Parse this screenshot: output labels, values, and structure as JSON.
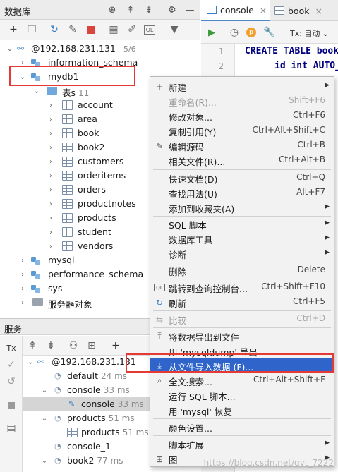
{
  "left_panel": {
    "title": "数据库",
    "header_icons": [
      "crosshair-icon",
      "collapse-icon",
      "expand-icon",
      "gear-icon",
      "minimize-icon"
    ]
  },
  "db_toolbar": {
    "icons": [
      "add-icon",
      "copy-icon",
      "refresh-icon",
      "edit-props-icon",
      "stop-icon",
      "table-view-icon",
      "pencil-icon",
      "query-console-icon",
      "filter-icon"
    ]
  },
  "tree": {
    "connection": {
      "label": "@192.168.231.131",
      "badge": "5/6"
    },
    "schema_information": "information_schema",
    "mydb": "mydb1",
    "tables_folder": {
      "label": "表s",
      "count": "11"
    },
    "tables": [
      "account",
      "area",
      "book",
      "book2",
      "customers",
      "orderitems",
      "orders",
      "productnotes",
      "products",
      "student",
      "vendors"
    ],
    "other_schemas": [
      "mysql",
      "performance_schema",
      "sys"
    ],
    "server_objects": "服务器对象"
  },
  "services": {
    "title": "服务",
    "tx_label": "Tx",
    "toolbar_icons": [
      "collapse-icon",
      "expand-icon",
      "group-icon",
      "layout-icon",
      "add-icon"
    ],
    "side_icons": [
      "check-icon",
      "rollback-icon",
      "stop-icon",
      "layout-icon"
    ],
    "tree": [
      {
        "label": "@192.168.231.131",
        "time": ""
      },
      {
        "label": "default",
        "time": "24 ms"
      },
      {
        "label": "console",
        "time": "33 ms"
      },
      {
        "label": "console",
        "time": "33 ms"
      },
      {
        "label": "products",
        "time": "51 ms"
      },
      {
        "label": "products",
        "time": "51 ms"
      },
      {
        "label": "console_1",
        "time": ""
      },
      {
        "label": "book2",
        "time": "77 ms"
      }
    ]
  },
  "editor": {
    "tabs": [
      {
        "label": "console",
        "close": "×"
      },
      {
        "label": "book",
        "close": "×"
      }
    ],
    "tx_label": "Tx: 自动",
    "line_numbers": [
      "1",
      "2"
    ],
    "code_lines": [
      "CREATE TABLE book",
      "id int AUTO_"
    ]
  },
  "context_menu": {
    "items": [
      {
        "label": "新建",
        "shortcut": "",
        "submenu": true,
        "icon": "plus-icon",
        "disabled": false
      },
      {
        "label": "重命名(R)...",
        "shortcut": "Shift+F6",
        "submenu": false,
        "icon": "",
        "disabled": true
      },
      {
        "label": "修改对象...",
        "shortcut": "Ctrl+F6",
        "submenu": false,
        "icon": "",
        "disabled": false
      },
      {
        "label": "复制引用(Y)",
        "shortcut": "Ctrl+Alt+Shift+C",
        "submenu": false,
        "icon": "",
        "disabled": false
      },
      {
        "label": "编辑源码",
        "shortcut": "Ctrl+B",
        "submenu": false,
        "icon": "pencil-icon",
        "disabled": false
      },
      {
        "label": "相关文件(R)...",
        "shortcut": "Ctrl+Alt+B",
        "submenu": false,
        "icon": "",
        "disabled": false
      },
      {
        "label": "快速文档(D)",
        "shortcut": "Ctrl+Q",
        "submenu": false,
        "icon": "",
        "disabled": false
      },
      {
        "label": "查找用法(U)",
        "shortcut": "Alt+F7",
        "submenu": false,
        "icon": "",
        "disabled": false
      },
      {
        "label": "添加到收藏夹(A)",
        "shortcut": "",
        "submenu": true,
        "icon": "",
        "disabled": false
      },
      {
        "label": "SQL 脚本",
        "shortcut": "",
        "submenu": true,
        "icon": "",
        "disabled": false
      },
      {
        "label": "数据库工具",
        "shortcut": "",
        "submenu": true,
        "icon": "",
        "disabled": false
      },
      {
        "label": "诊断",
        "shortcut": "",
        "submenu": true,
        "icon": "",
        "disabled": false
      },
      {
        "label": "删除",
        "shortcut": "Delete",
        "submenu": false,
        "icon": "",
        "disabled": false
      },
      {
        "label": "跳转到查询控制台...",
        "shortcut": "Ctrl+Shift+F10",
        "submenu": false,
        "icon": "console-icon",
        "disabled": false
      },
      {
        "label": "刷新",
        "shortcut": "Ctrl+F5",
        "submenu": false,
        "icon": "refresh-icon",
        "disabled": false
      },
      {
        "label": "比较",
        "shortcut": "Ctrl+D",
        "submenu": false,
        "icon": "compare-icon",
        "disabled": true
      },
      {
        "label": "将数据导出到文件",
        "shortcut": "",
        "submenu": false,
        "icon": "export-icon",
        "disabled": false
      },
      {
        "label": "用 'mysqldump' 导出",
        "shortcut": "",
        "submenu": false,
        "icon": "",
        "disabled": false
      },
      {
        "label": "从文件导入数据 (F)...",
        "shortcut": "",
        "submenu": false,
        "icon": "import-icon",
        "disabled": false,
        "highlighted": true
      },
      {
        "label": "全文搜索...",
        "shortcut": "Ctrl+Alt+Shift+F",
        "submenu": false,
        "icon": "search-icon",
        "disabled": false
      },
      {
        "label": "运行 SQL 脚本...",
        "shortcut": "",
        "submenu": false,
        "icon": "",
        "disabled": false
      },
      {
        "label": "用 'mysql' 恢复",
        "shortcut": "",
        "submenu": false,
        "icon": "",
        "disabled": false
      },
      {
        "label": "颜色设置...",
        "shortcut": "",
        "submenu": false,
        "icon": "",
        "disabled": false
      },
      {
        "label": "脚本扩展",
        "shortcut": "",
        "submenu": true,
        "icon": "",
        "disabled": false
      },
      {
        "label": "图",
        "shortcut": "",
        "submenu": true,
        "icon": "diagram-icon",
        "disabled": false
      }
    ]
  },
  "watermark": "https://blog.csdn.net/qyt_7222"
}
